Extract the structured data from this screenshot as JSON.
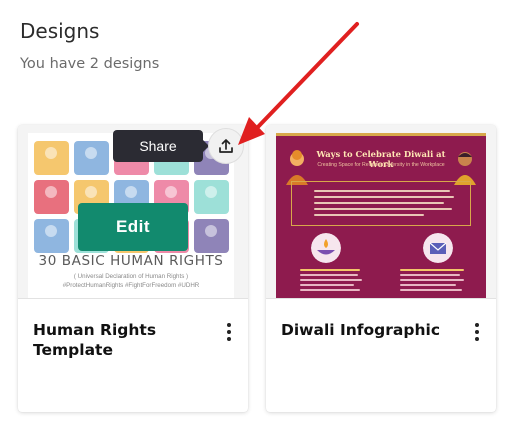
{
  "page": {
    "title": "Designs",
    "subtitle": "You have 2 designs"
  },
  "designs": [
    {
      "title": "Human Rights Template",
      "edit_label": "Edit",
      "share_label": "Share",
      "thumbnail": {
        "heading": "30 BASIC HUMAN RIGHTS",
        "subheading": "( Universal Declaration of Human Rights )",
        "hashtags": "#ProtectHumanRights #FightForFreedom #UDHR"
      }
    },
    {
      "title": "Diwali Infographic",
      "thumbnail": {
        "heading": "Ways to Celebrate Diwali at Work",
        "subheading": "Creating Space for Religious Diversity in the Workplace"
      }
    }
  ],
  "colors": {
    "edit_button": "#128a6e",
    "tooltip": "#2b2b33",
    "annotation_arrow": "#e02020",
    "diwali_background": "#8e1b4e"
  },
  "icons": {
    "share": "upload-icon",
    "more": "kebab-menu-icon"
  }
}
